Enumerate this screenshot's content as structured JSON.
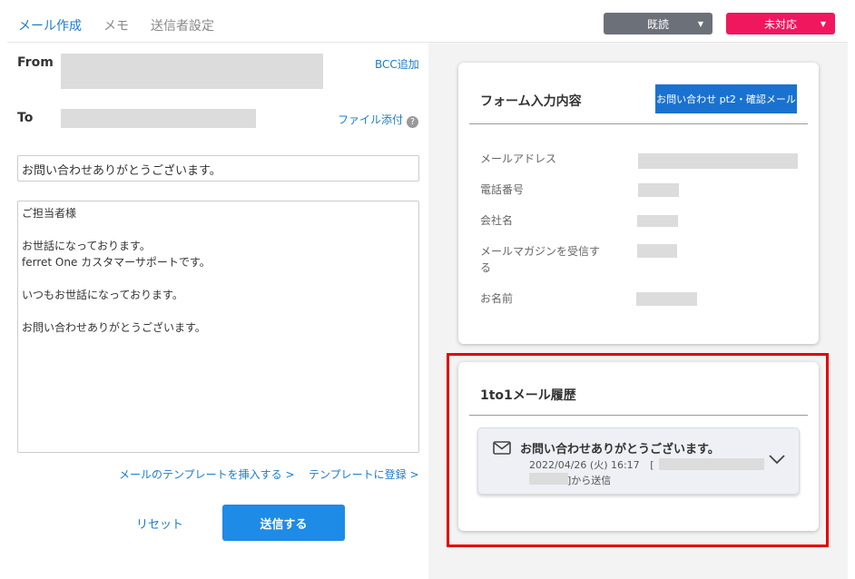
{
  "tabs": [
    {
      "label": "メール作成"
    },
    {
      "label": "メモ"
    },
    {
      "label": "送信者設定"
    }
  ],
  "status": {
    "read_label": "既読",
    "unhandled_label": "未対応",
    "read_color": "#6c7079",
    "unhandled_color": "#f0175f"
  },
  "compose": {
    "from_label": "From",
    "to_label": "To",
    "bcc_link": "BCC追加",
    "attach_link": "ファイル添付",
    "help_glyph": "?",
    "subject_value": "お問い合わせありがとうございます。",
    "body_value": "ご担当者様\n\nお世話になっております。\nferret One カスタマーサポートです。\n\nいつもお世話になっております。\n\nお問い合わせありがとうございます。",
    "insert_template_link": "メールのテンプレートを挿入する >",
    "register_template_link": "テンプレートに登録 >",
    "reset_label": "リセット",
    "send_label": "送信する"
  },
  "form_card": {
    "title": "フォーム入力内容",
    "form_button": "お問い合わせ pt2・確認メール",
    "rows": [
      {
        "label": "メールアドレス"
      },
      {
        "label": "電話番号"
      },
      {
        "label": "会社名"
      },
      {
        "label": "メールマガジンを受信する"
      },
      {
        "label": "お名前"
      }
    ]
  },
  "history_card": {
    "title": "1to1メール履歴",
    "item": {
      "icon": "mail-icon",
      "subject": "お問い合わせありがとうございます。",
      "datetime": "2022/04/26 (火) 16:17",
      "bracket_open": "[",
      "sent_suffix": "]から送信"
    }
  },
  "colors": {
    "accent": "#1a7bd0",
    "send_button": "#1e8be6",
    "highlight_border": "#e60000"
  }
}
